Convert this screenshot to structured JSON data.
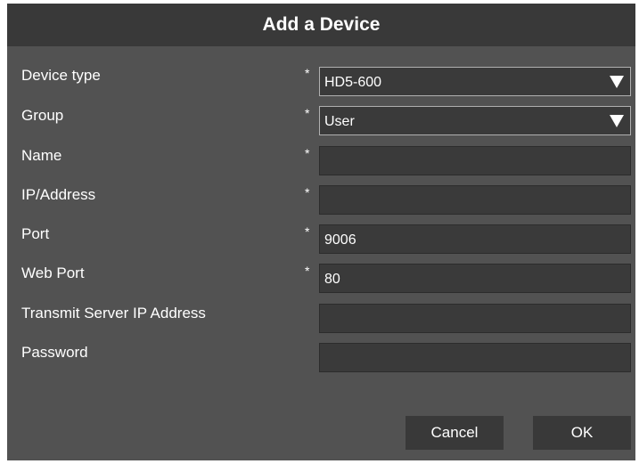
{
  "dialog": {
    "title": "Add a Device"
  },
  "form": {
    "device_type": {
      "label": "Device type",
      "required_mark": "*",
      "value": "HD5-600"
    },
    "group": {
      "label": "Group",
      "required_mark": "*",
      "value": "User"
    },
    "name": {
      "label": "Name",
      "required_mark": "*",
      "value": ""
    },
    "ip_address": {
      "label": "IP/Address",
      "required_mark": "*",
      "value": ""
    },
    "port": {
      "label": "Port",
      "required_mark": "*",
      "value": "9006"
    },
    "web_port": {
      "label": "Web Port",
      "required_mark": "*",
      "value": "80"
    },
    "transmit_server_ip": {
      "label": "Transmit Server IP Address",
      "value": ""
    },
    "password": {
      "label": "Password",
      "value": ""
    }
  },
  "buttons": {
    "cancel": "Cancel",
    "ok": "OK"
  },
  "icons": {
    "dropdown": "triangle-down-icon"
  },
  "colors": {
    "dialog_background": "#525252",
    "title_bar": "#393939",
    "field_background": "#3a3a3a",
    "text": "#ffffff"
  }
}
